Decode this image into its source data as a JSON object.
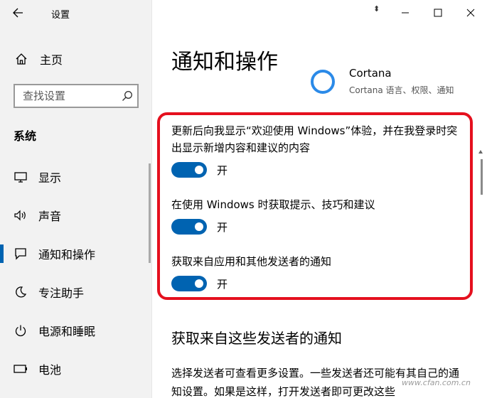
{
  "window": {
    "title": "设置",
    "resize_hint": "⬍"
  },
  "sidebar": {
    "home": "主页",
    "search": {
      "placeholder": "查找设置"
    },
    "section": "系统",
    "items": [
      {
        "label": "显示",
        "icon": "monitor-icon"
      },
      {
        "label": "声音",
        "icon": "speaker-icon"
      },
      {
        "label": "通知和操作",
        "icon": "message-icon",
        "active": true
      },
      {
        "label": "专注助手",
        "icon": "moon-icon"
      },
      {
        "label": "电源和睡眠",
        "icon": "power-icon"
      },
      {
        "label": "电池",
        "icon": "battery-icon"
      }
    ]
  },
  "main": {
    "title": "通知和操作",
    "cortana": {
      "name": "Cortana",
      "subtitle": "Cortana 语言、权限、通知"
    },
    "settings": [
      {
        "description": "更新后向我显示“欢迎使用 Windows”体验，并在我登录时突出显示新增内容和建议的内容",
        "state": "开",
        "on": true
      },
      {
        "description": "在使用 Windows 时获取提示、技巧和建议",
        "state": "开",
        "on": true
      },
      {
        "description": "获取来自应用和其他发送者的通知",
        "state": "开",
        "on": true
      }
    ],
    "section2": {
      "title": "获取来自这些发送者的通知",
      "body": "选择发送者可查看更多设置。一些发送者还可能有其自己的通知设置。如果是这样，打开发送者即可更改这些"
    },
    "watermark": "www.cfan.com.cn"
  },
  "colors": {
    "accent": "#0063b1",
    "highlight": "#e5101e",
    "sidebar_bg": "#f2f2f2"
  }
}
